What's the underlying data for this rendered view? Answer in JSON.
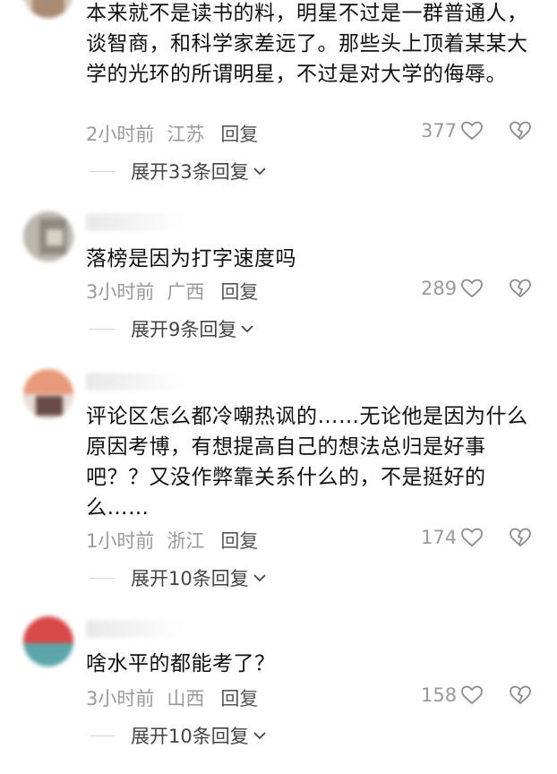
{
  "comments": [
    {
      "text": "本来就不是读书的料，明星不过是一群普通人，谈智商，和科学家差远了。那些头上顶着某某大学的光环的所谓明星，不过是对大学的侮辱。",
      "time": "2小时前",
      "location": "江苏",
      "reply_label": "回复",
      "likes": "377",
      "expand_label": "展开33条回复"
    },
    {
      "text": "落榜是因为打字速度吗",
      "time": "3小时前",
      "location": "广西",
      "reply_label": "回复",
      "likes": "289",
      "expand_label": "展开9条回复"
    },
    {
      "text": "评论区怎么都冷嘲热讽的……无论他是因为什么原因考博，有想提高自己的想法总归是好事吧？？又没作弊靠关系什么的，不是挺好的么……",
      "time": "1小时前",
      "location": "浙江",
      "reply_label": "回复",
      "likes": "174",
      "expand_label": "展开10条回复"
    },
    {
      "text": "啥水平的都能考了？",
      "time": "3小时前",
      "location": "山西",
      "reply_label": "回复",
      "likes": "158",
      "expand_label": "展开10条回复"
    }
  ],
  "icons": {
    "like": "heart-outline-icon",
    "dislike": "broken-heart-icon",
    "expand": "chevron-down-icon"
  },
  "colors": {
    "text": "#111111",
    "meta": "#9a9a9a",
    "reply": "#555555"
  }
}
